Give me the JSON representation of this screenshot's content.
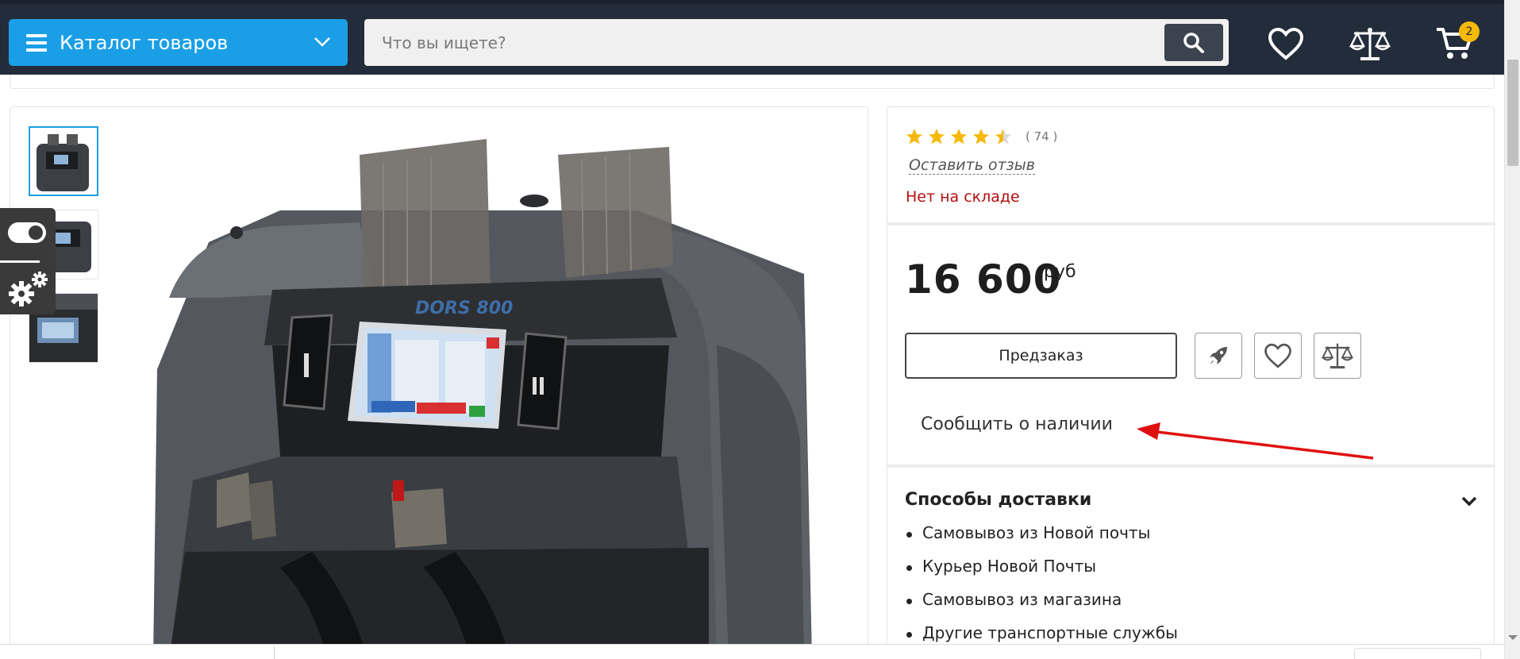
{
  "header": {
    "catalog_label": "Каталог товаров",
    "search_placeholder": "Что вы ищете?",
    "cart_count": "2",
    "icons": [
      "menu-icon",
      "chevron-down-icon",
      "search-icon",
      "heart-icon",
      "scales-icon",
      "cart-icon"
    ]
  },
  "side_widget": {
    "icons": [
      "toggle-icon",
      "gears-icon"
    ]
  },
  "product": {
    "rating": 4.5,
    "rating_count": "( 74 )",
    "review_link": "Оставить отзыв",
    "stock_status": "Нет на складе",
    "price": "16 600",
    "currency": "руб",
    "preorder_label": "Предзаказ",
    "notify_label": "Сообщить о наличии",
    "action_icons": [
      "rocket-icon",
      "heart-icon",
      "scales-icon"
    ],
    "screen_brand": "DORS 800"
  },
  "delivery": {
    "title": "Способы доставки",
    "items": [
      "Самовывоз из Новой почты",
      "Курьер Новой Почты",
      "Самовывоз из магазина",
      "Другие транспортные службы"
    ]
  },
  "colors": {
    "header_bg": "#232c3b",
    "catalog_blue": "#1a9fe6",
    "badge_yellow": "#f5b90a",
    "stock_red": "#b50e0e",
    "star_yellow": "#f5b90a",
    "annotation_red": "#e01010"
  }
}
